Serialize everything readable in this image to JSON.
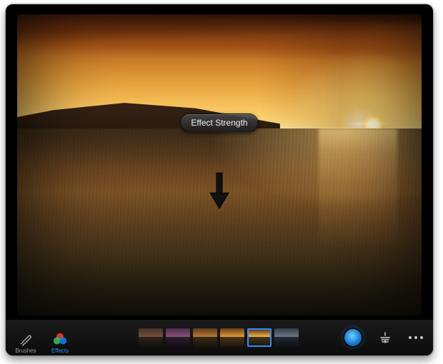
{
  "hud": {
    "tooltip": "Effect Strength"
  },
  "toolbar": {
    "brushes_label": "Brushes",
    "effects_label": "Effects",
    "active_tool": "effects"
  },
  "effects": {
    "thumbnails": [
      {
        "selected": false
      },
      {
        "selected": false
      },
      {
        "selected": false
      },
      {
        "selected": false
      },
      {
        "selected": true
      },
      {
        "selected": false
      }
    ]
  },
  "annotation": {
    "arrow_direction": "down"
  },
  "colors": {
    "accent": "#2e8dff"
  }
}
